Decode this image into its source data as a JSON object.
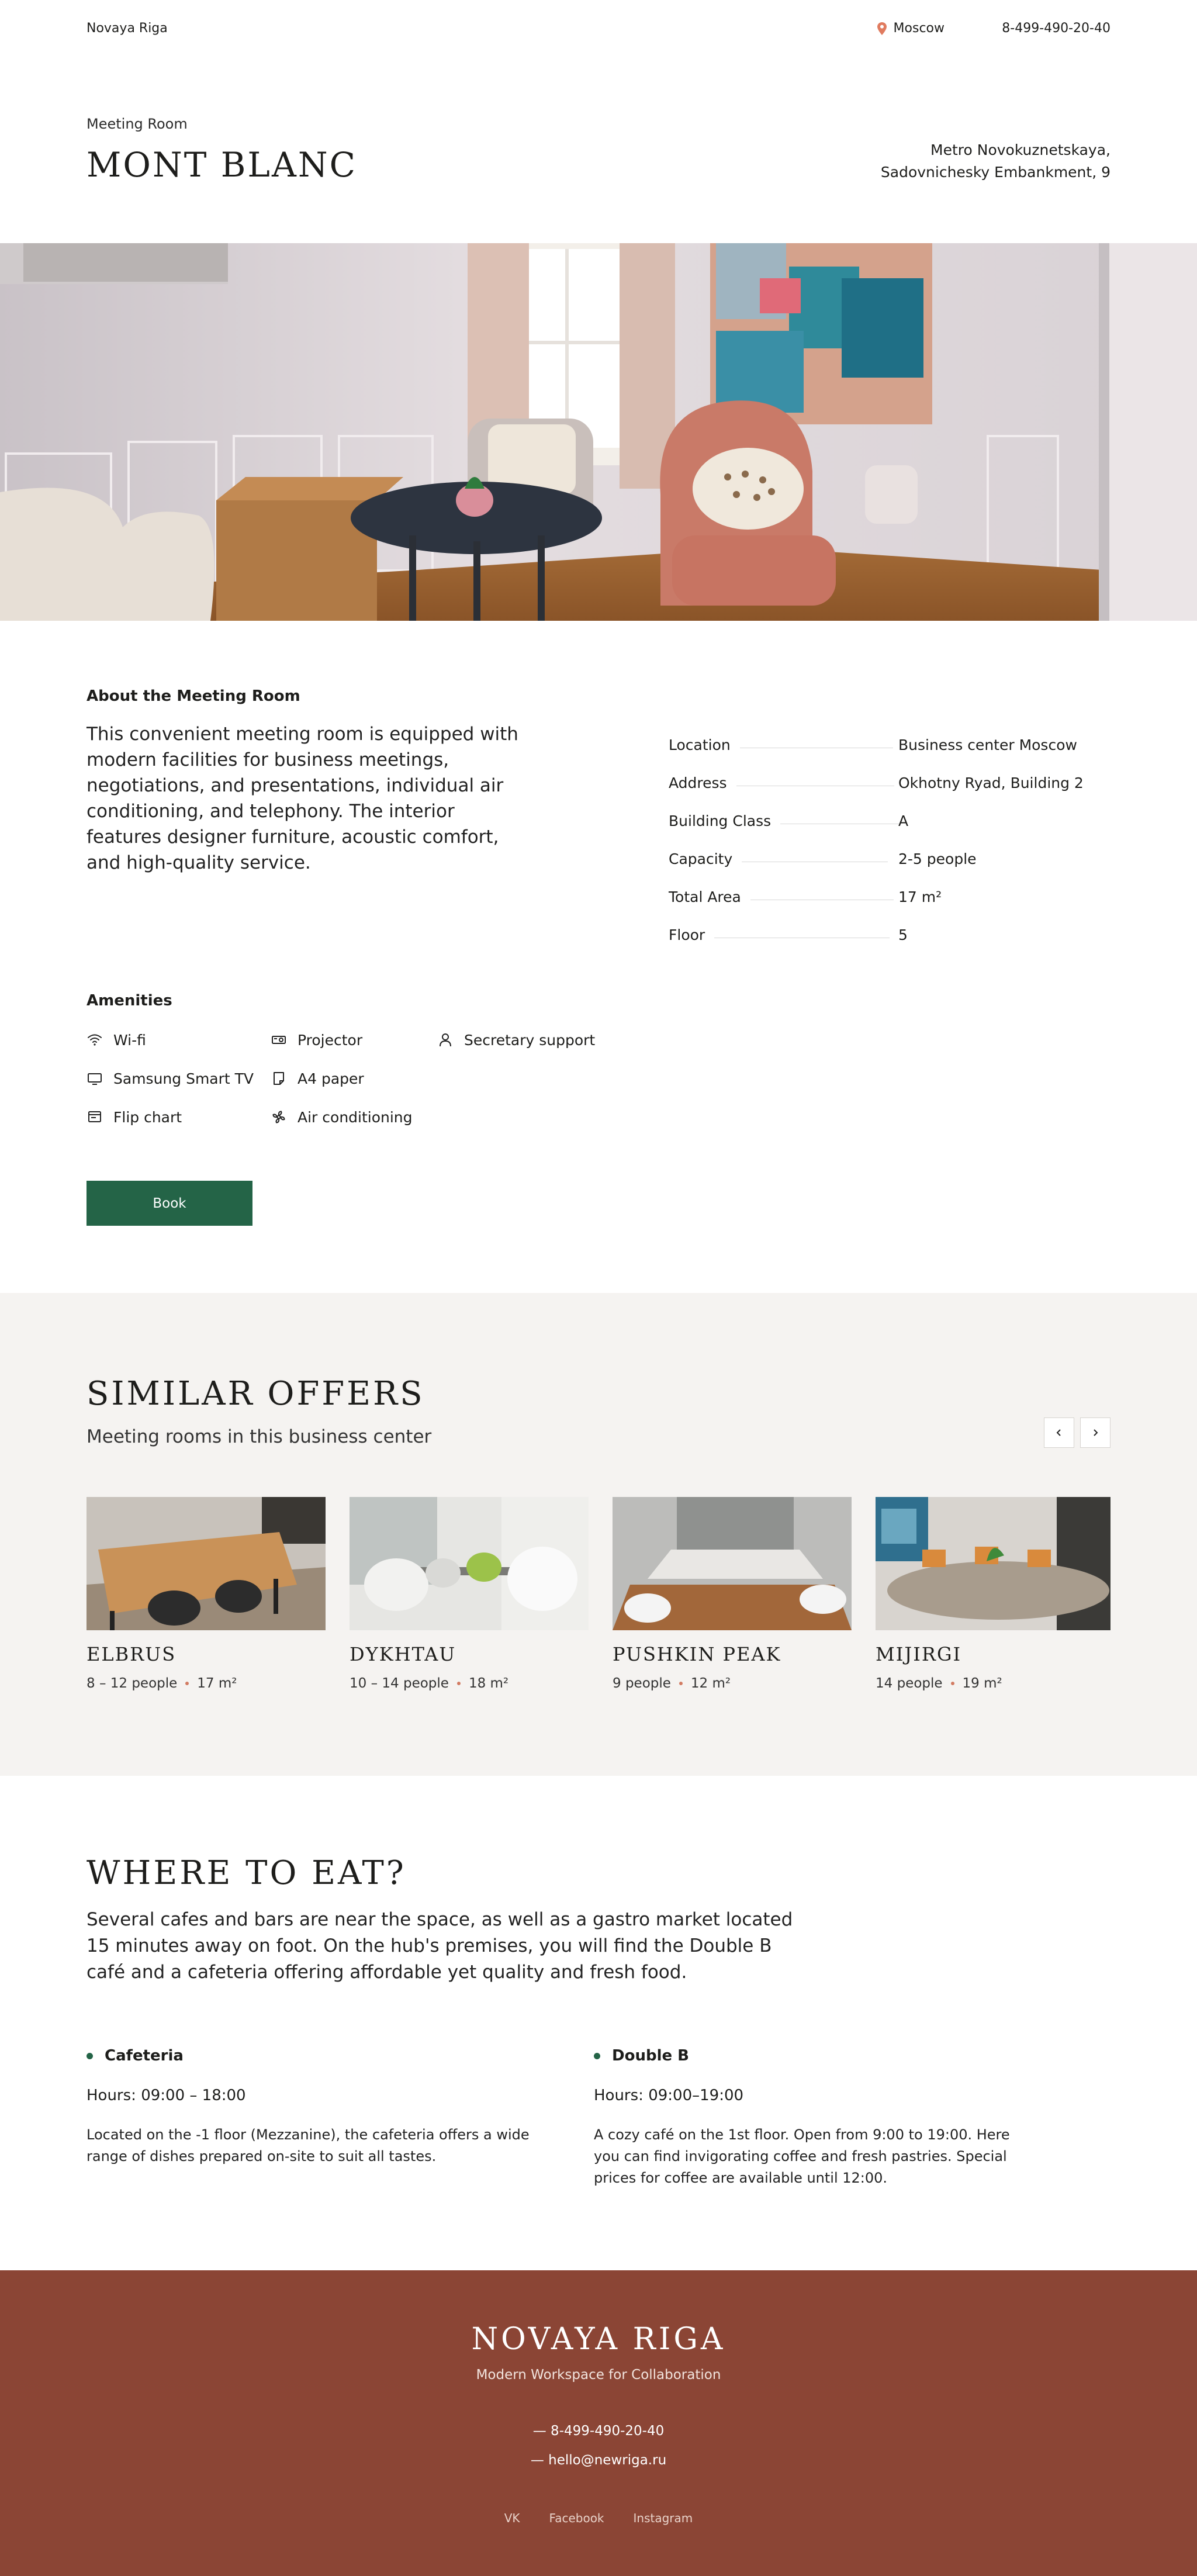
{
  "header": {
    "brand": "Novaya Riga",
    "city": "Moscow",
    "phone": "8-499-490-20-40"
  },
  "room": {
    "overline": "Meeting Room",
    "name": "MONT BLANC",
    "metro_line1": "Metro Novokuznetskaya,",
    "metro_line2": "Sadovnichesky Embankment, 9"
  },
  "about": {
    "heading": "About the Meeting Room",
    "text": "This convenient meeting room is equipped with modern facilities for business meetings, negotiations, and presentations, individual air conditioning, and telephony. The interior features designer furniture, acoustic comfort, and high-quality service.",
    "specs": [
      {
        "label": "Location",
        "value": "Business center Moscow"
      },
      {
        "label": "Address",
        "value": "Okhotny Ryad, Building 2"
      },
      {
        "label": "Building Class",
        "value": "A"
      },
      {
        "label": "Capacity",
        "value": "2-5 people"
      },
      {
        "label": "Total Area",
        "value": "17 m²"
      },
      {
        "label": "Floor",
        "value": "5"
      }
    ]
  },
  "amenities": {
    "heading": "Amenities",
    "items": [
      {
        "label": "Wi-fi",
        "icon": "wifi-icon"
      },
      {
        "label": "Projector",
        "icon": "projector-icon"
      },
      {
        "label": "Secretary support",
        "icon": "person-icon"
      },
      {
        "label": "Samsung Smart TV",
        "icon": "tv-icon"
      },
      {
        "label": "A4 paper",
        "icon": "paper-icon"
      },
      {
        "label": "Flip chart",
        "icon": "flipchart-icon"
      },
      {
        "label": "Air conditioning",
        "icon": "fan-icon"
      }
    ],
    "book_label": "Book"
  },
  "similar": {
    "title": "SIMILAR OFFERS",
    "subtitle": "Meeting rooms in this business center",
    "prev_icon": "chevron-left-icon",
    "next_icon": "chevron-right-icon",
    "cards": [
      {
        "name": "ELBRUS",
        "people": "8 – 12 people",
        "area": "17 m²"
      },
      {
        "name": "DYKHTAU",
        "people": "10 – 14 people",
        "area": "18 m²"
      },
      {
        "name": "PUSHKIN PEAK",
        "people": "9 people",
        "area": "12 m²"
      },
      {
        "name": "MIJIRGI",
        "people": "14 people",
        "area": "19 m²"
      }
    ]
  },
  "eat": {
    "title": "WHERE TO EAT?",
    "text": "Several cafes and bars are near the space, as well as a gastro market located 15 minutes away on foot. On the hub's premises, you will find the Double B café and a cafeteria offering affordable yet quality and fresh food.",
    "places": [
      {
        "name": "Cafeteria",
        "hours": "Hours: 09:00 – 18:00",
        "desc": "Located on the -1 floor (Mezzanine), the cafeteria offers a wide range of dishes prepared on-site to suit all tastes."
      },
      {
        "name": "Double B",
        "hours": "Hours: 09:00–19:00",
        "desc": "A cozy café on the 1st floor. Open from 9:00 to 19:00. Here you can find invigorating coffee and fresh pastries. Special prices for coffee are available until 12:00."
      }
    ]
  },
  "footer": {
    "brand": "NOVAYA RIGA",
    "tagline": "Modern Workspace for Collaboration",
    "phone": "— 8-499-490-20-40",
    "email": "— hello@newriga.ru",
    "links": [
      "VK",
      "Facebook",
      "Instagram"
    ]
  },
  "colors": {
    "accent_green": "#246447",
    "footer_bg": "#8b4535",
    "pin": "#e07b5f",
    "section_bg": "#f5f3f1"
  }
}
